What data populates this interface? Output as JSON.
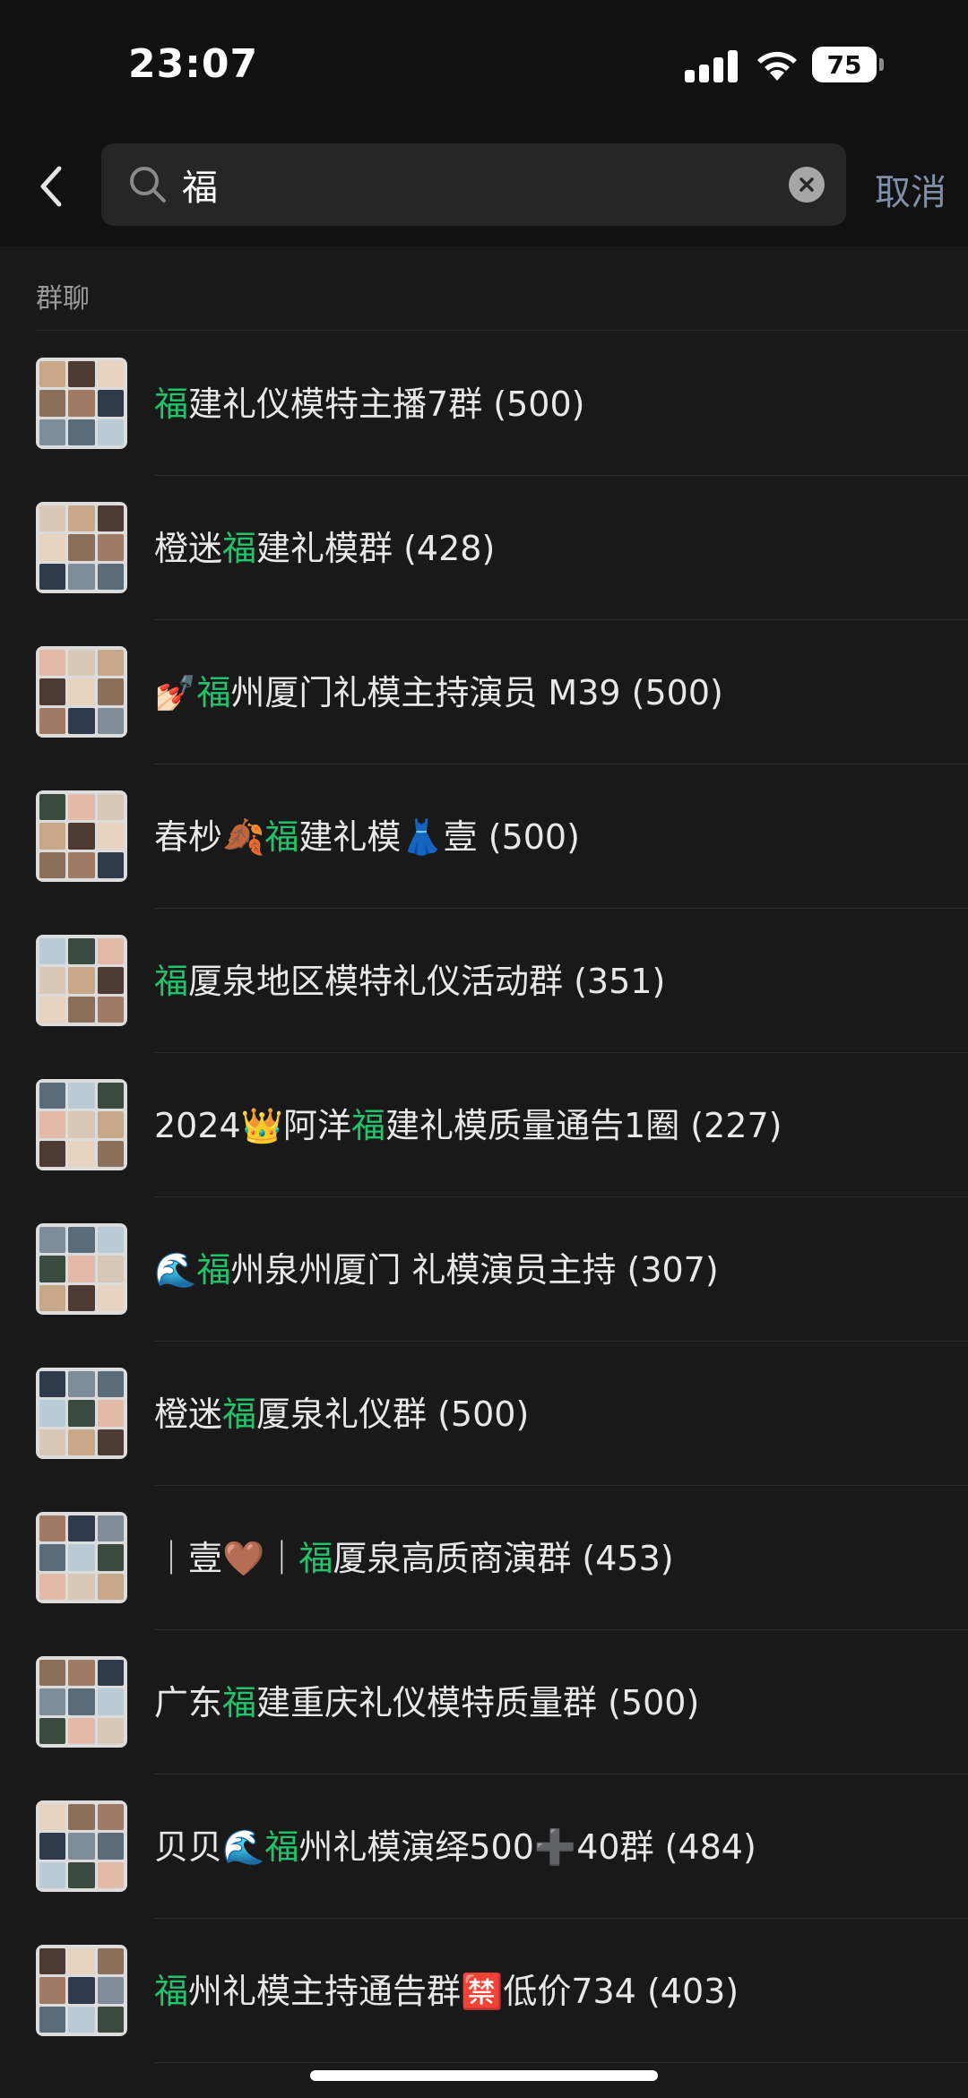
{
  "status": {
    "time": "23:07",
    "battery": "75"
  },
  "search": {
    "query": "福",
    "cancel_label": "取消"
  },
  "section_title": "群聊",
  "highlight_color": "#21c36b",
  "results": [
    {
      "pre": "",
      "hl": "福",
      "post": "建礼仪模特主播7群 (500)"
    },
    {
      "pre": "橙迷",
      "hl": "福",
      "post": "建礼模群 (428)"
    },
    {
      "pre": "💅🏻",
      "hl": "福",
      "post": "州厦门礼模主持演员 M39 (500)"
    },
    {
      "pre": "春杪🍂",
      "hl": "福",
      "post": "建礼模👗壹 (500)"
    },
    {
      "pre": "",
      "hl": "福",
      "post": "厦泉地区模特礼仪活动群 (351)"
    },
    {
      "pre": "2024👑阿洋",
      "hl": "福",
      "post": "建礼模质量通告1圈 (227)"
    },
    {
      "pre": "🌊",
      "hl": "福",
      "post": "州泉州厦门 礼模演员主持 (307)"
    },
    {
      "pre": "橙迷",
      "hl": "福",
      "post": "厦泉礼仪群 (500)"
    },
    {
      "pre": "｜壹🤎｜",
      "hl": "福",
      "post": "厦泉高质商演群 (453)"
    },
    {
      "pre": "广东",
      "hl": "福",
      "post": "建重庆礼仪模特质量群 (500)"
    },
    {
      "pre": "贝贝🌊",
      "hl": "福",
      "post": "州礼模演绎500➕40群 (484)"
    },
    {
      "pre": "",
      "hl": "福",
      "post": "州礼模主持通告群🈲低价734 (403)"
    }
  ]
}
